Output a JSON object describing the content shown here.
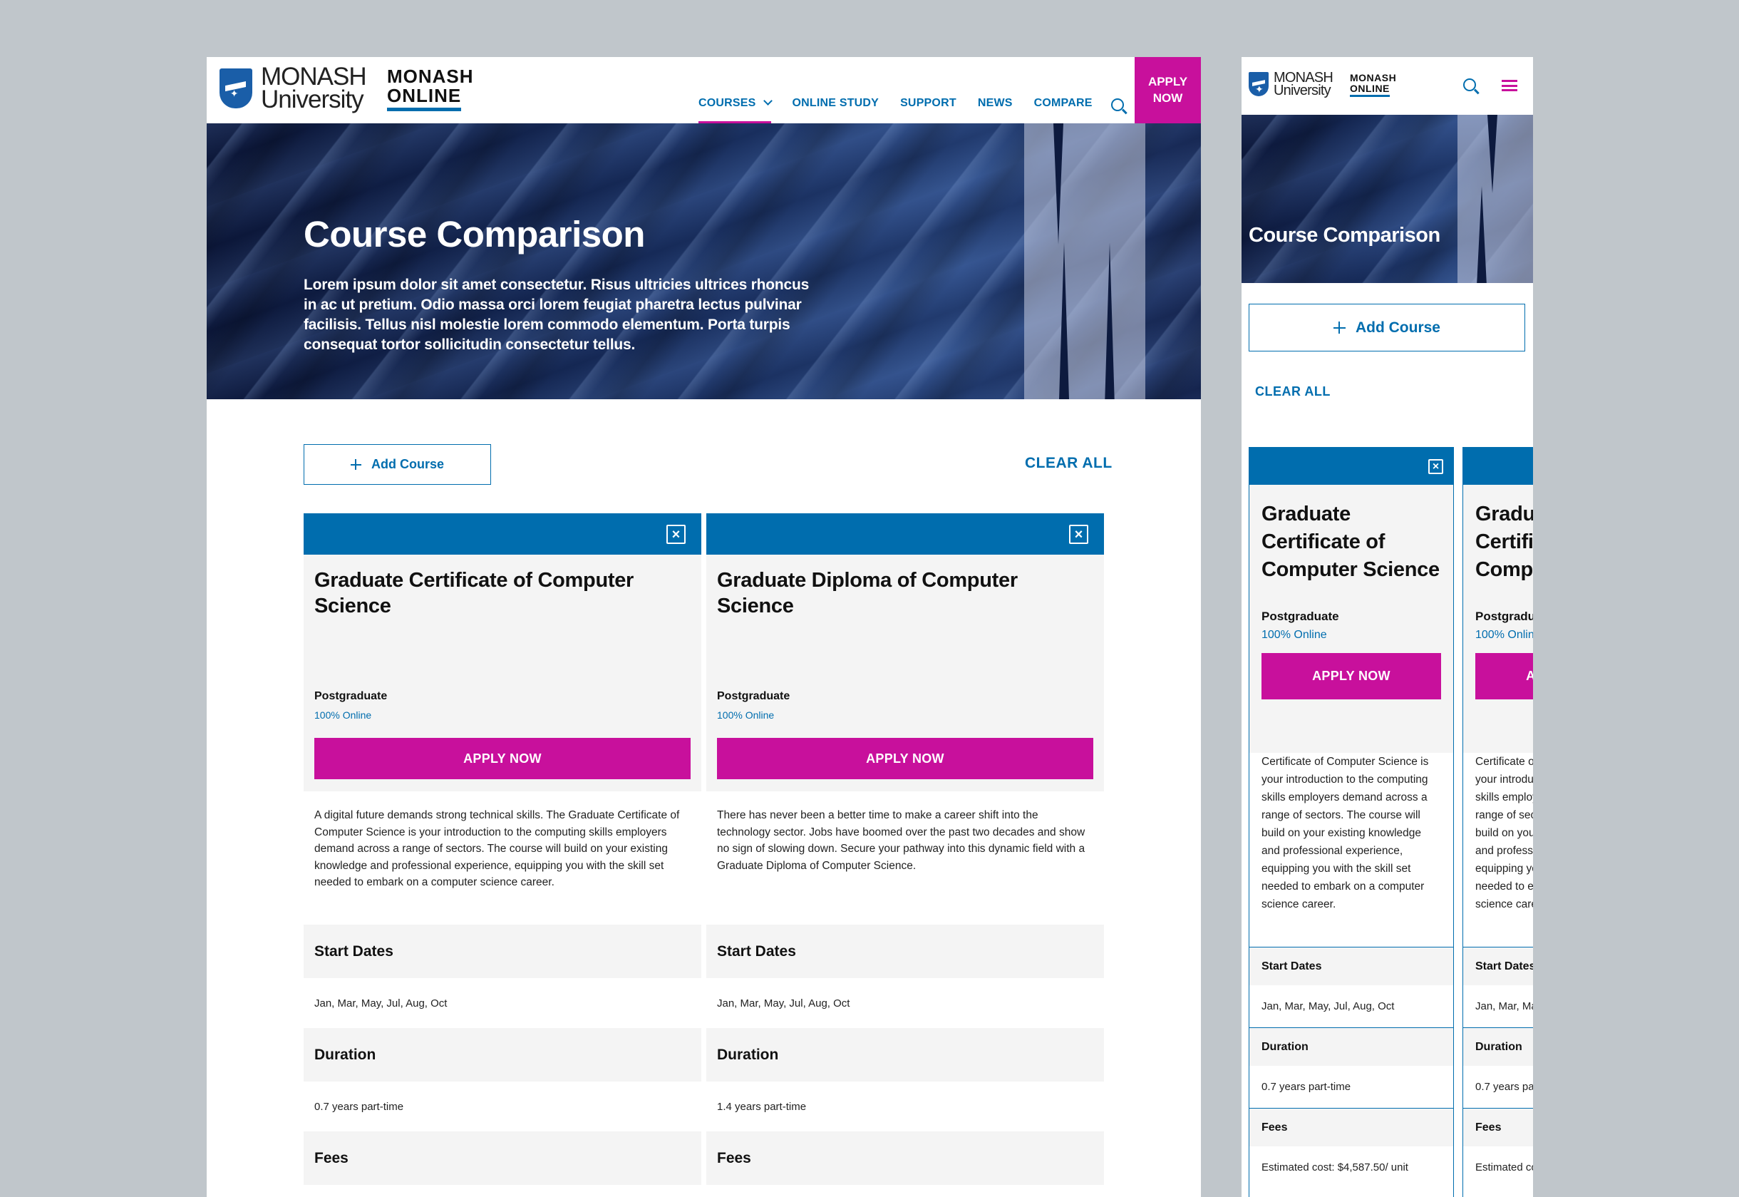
{
  "brand": {
    "university_line1": "MONASH",
    "university_line2": "University",
    "online_line1": "MONASH",
    "online_line2": "ONLINE"
  },
  "nav": {
    "items": [
      "COURSES",
      "ONLINE STUDY",
      "SUPPORT",
      "NEWS",
      "COMPARE"
    ],
    "apply_line1": "APPLY",
    "apply_line2": "NOW"
  },
  "hero": {
    "title": "Course Comparison",
    "body": "Lorem ipsum dolor sit amet consectetur. Risus ultricies ultrices rhoncus in ac ut pretium. Odio massa orci lorem feugiat pharetra lectus pulvinar facilisis. Tellus nisl molestie lorem commodo elementum. Porta turpis consequat tortor sollicitudin consectetur tellus."
  },
  "controls": {
    "add_course": "Add Course",
    "clear_all": "CLEAR ALL"
  },
  "labels": {
    "start_dates": "Start Dates",
    "duration": "Duration",
    "fees": "Fees",
    "apply_now": "APPLY NOW"
  },
  "courses": [
    {
      "title": "Graduate Certificate of Computer Science",
      "mobile_title": "Graduate Certificate of Computer Science",
      "level": "Postgraduate",
      "mode": "100% Online",
      "description": "A digital future demands strong technical skills. The Graduate Certificate of Computer Science is your introduction to the computing skills employers demand across a range of sectors. The course will build on your existing knowledge and professional experience, equipping you with the skill set needed to embark on a computer science career.",
      "start_dates": "Jan, Mar, May, Jul, Aug, Oct",
      "duration": "0.7 years part-time",
      "fees": "Estimated cost: $4,587.50/ unit"
    },
    {
      "title": "Graduate Diploma of Computer Science",
      "level": "Postgraduate",
      "mode": "100% Online",
      "description": "There has never been a better time to make a career shift into the technology sector. Jobs have boomed over the past two decades and show no sign of slowing down. Secure your pathway into this dynamic field with a Graduate Diploma of Computer Science.",
      "start_dates": "Jan, Mar, May, Jul, Aug, Oct",
      "duration": "1.4 years part-time"
    }
  ],
  "mobile_peek": {
    "title": "Graduate Certificate of Computer Science",
    "level": "Postgraduate",
    "mode": "100% Online",
    "description": "A digital future demands strong technical skills. The Graduate Certificate of Computer Science is your introduction to the computing skills employers demand across a range of sectors. The course will build on your existing knowledge and professional experience, equipping you with the skill set needed to embark on a computer science career.",
    "start_dates": "Jan, Mar, May, Jul, Aug, Oct",
    "duration": "0.7 years part-time",
    "fees": "Estimated cost: $4,587.50/ unit"
  },
  "icons": {
    "search": "search-icon",
    "menu": "hamburger-menu-icon",
    "close": "close-icon",
    "plus": "plus-icon",
    "chevron": "chevron-down-icon"
  },
  "colors": {
    "primary_blue": "#006dae",
    "magenta": "#c8109c",
    "panel_grey": "#f4f4f4",
    "backdrop": "#c0c6cb"
  }
}
